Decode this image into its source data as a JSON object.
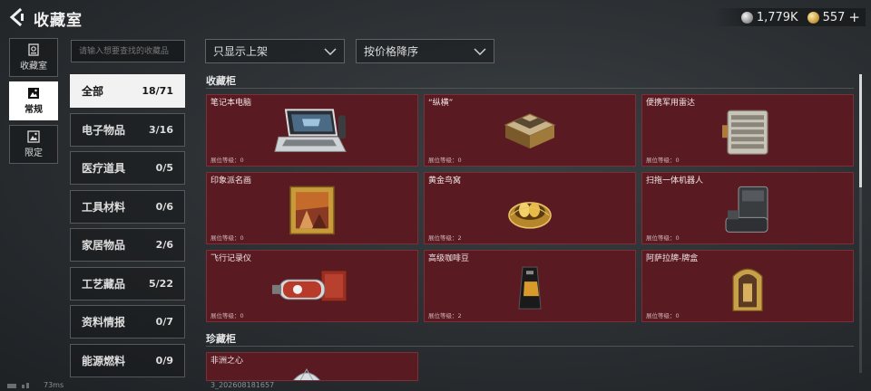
{
  "header": {
    "title": "收藏室"
  },
  "currency": {
    "silver_value": "1,779K",
    "gold_value": "557",
    "plus_label": "+"
  },
  "nav": [
    {
      "label": "收藏室",
      "icon": "collection-icon",
      "active": false
    },
    {
      "label": "常规",
      "icon": "picture-icon",
      "active": true
    },
    {
      "label": "限定",
      "icon": "limited-picture-icon",
      "active": false
    }
  ],
  "search": {
    "placeholder": "请输入想要查找的收藏品"
  },
  "filters": {
    "display_option": "只显示上架",
    "sort_option": "按价格降序"
  },
  "categories": [
    {
      "name": "全部",
      "count": "18/71",
      "active": true
    },
    {
      "name": "电子物品",
      "count": "3/16",
      "active": false
    },
    {
      "name": "医疗道具",
      "count": "0/5",
      "active": false
    },
    {
      "name": "工具材料",
      "count": "0/6",
      "active": false
    },
    {
      "name": "家居物品",
      "count": "2/6",
      "active": false
    },
    {
      "name": "工艺藏品",
      "count": "5/22",
      "active": false
    },
    {
      "name": "资料情报",
      "count": "0/7",
      "active": false
    },
    {
      "name": "能源燃料",
      "count": "0/9",
      "active": false
    }
  ],
  "sections": {
    "cabinet": {
      "title": "收藏柜",
      "items": [
        {
          "name": "笔记本电脑",
          "level": "展位等级：0",
          "icon": "laptop-icon"
        },
        {
          "name": "“纵横”",
          "level": "展位等级：0",
          "icon": "chessboard-icon"
        },
        {
          "name": "便携军用雷达",
          "level": "展位等级：0",
          "icon": "radar-icon"
        },
        {
          "name": "印象派名画",
          "level": "展位等级：0",
          "icon": "painting-icon"
        },
        {
          "name": "黄金鸟窝",
          "level": "展位等级：2",
          "icon": "golden-nest-icon"
        },
        {
          "name": "扫拖一体机器人",
          "level": "展位等级：0",
          "icon": "robot-vacuum-icon"
        },
        {
          "name": "飞行记录仪",
          "level": "展位等级：0",
          "icon": "flight-recorder-icon"
        },
        {
          "name": "高级咖啡豆",
          "level": "展位等级：2",
          "icon": "coffee-bag-icon"
        },
        {
          "name": "阿萨拉牌-牌盒",
          "level": "展位等级：0",
          "icon": "card-box-icon"
        }
      ]
    },
    "treasure": {
      "title": "珍藏柜",
      "items": [
        {
          "name": "非洲之心",
          "level": "",
          "icon": "diamond-icon"
        }
      ]
    }
  },
  "footer": {
    "latency": "73ms",
    "build": "3_202608181657"
  },
  "colors": {
    "card_bg": "#5a1a22",
    "active_tab": "#ffffff",
    "page_bg": "#2a2e31"
  }
}
